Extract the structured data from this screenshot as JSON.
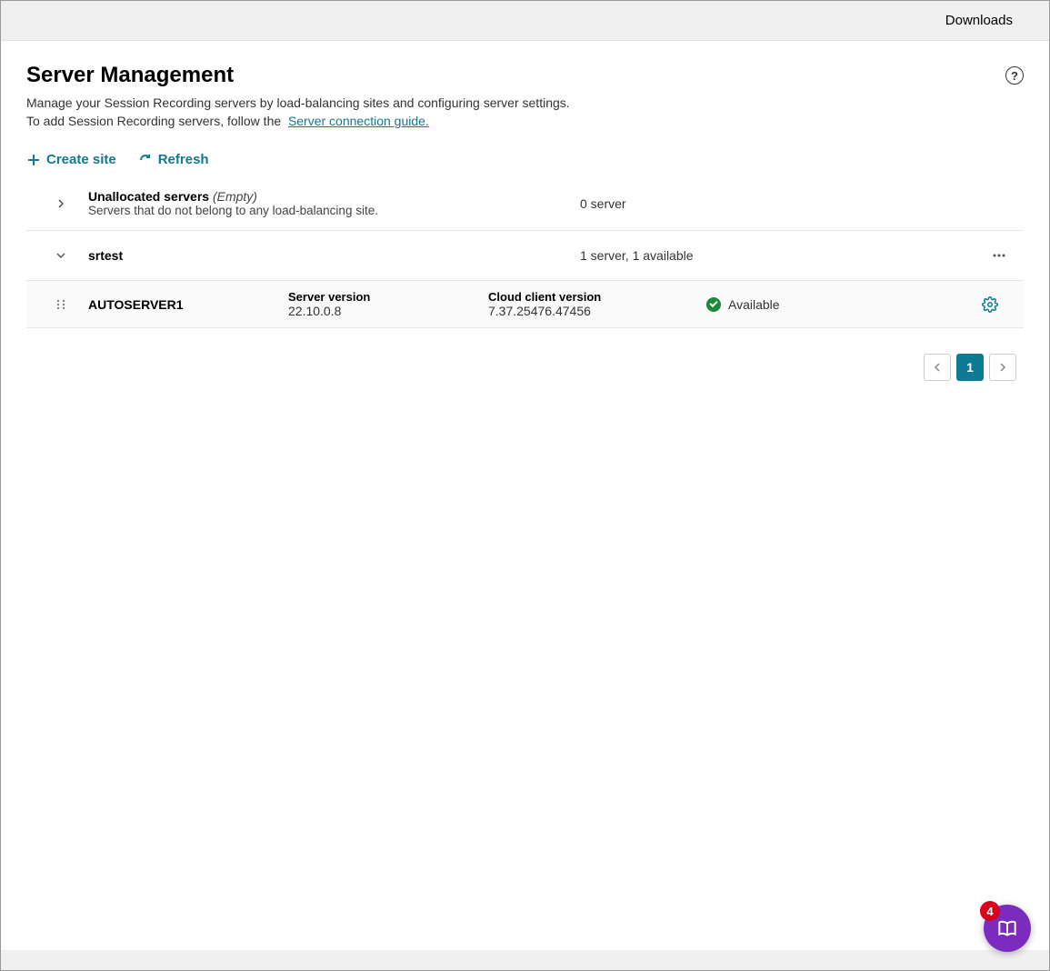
{
  "topbar": {
    "downloads": "Downloads"
  },
  "page": {
    "title": "Server Management",
    "desc1": "Manage your Session Recording servers by load-balancing sites and configuring server settings.",
    "desc2_prefix": "To add Session Recording servers, follow the",
    "guide_link": "Server connection guide."
  },
  "actions": {
    "create_site": "Create site",
    "refresh": "Refresh"
  },
  "unallocated": {
    "title": "Unallocated servers",
    "empty": "(Empty)",
    "sub": "Servers that do not belong to any load-balancing site.",
    "count": "0 server"
  },
  "sites": [
    {
      "name": "srtest",
      "count": "1 server, 1 available",
      "servers": [
        {
          "name": "AUTOSERVER1",
          "server_version_label": "Server version",
          "server_version": "22.10.0.8",
          "client_version_label": "Cloud client version",
          "client_version": "7.37.25476.47456",
          "status": "Available"
        }
      ]
    }
  ],
  "pagination": {
    "current": "1"
  },
  "fab": {
    "badge": "4"
  }
}
